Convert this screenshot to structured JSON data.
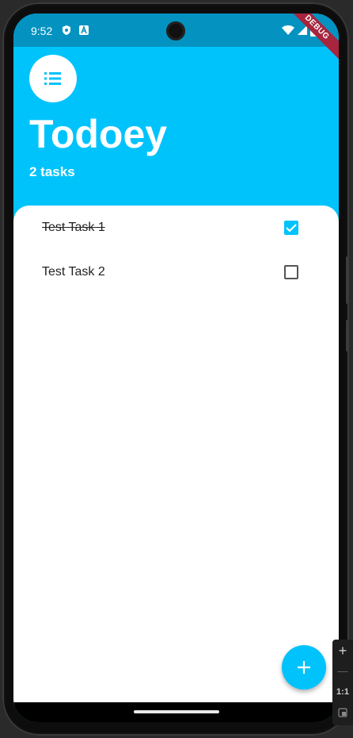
{
  "status_bar": {
    "time": "9:52",
    "debug_label": "DEBUG"
  },
  "header": {
    "title": "Todoey",
    "task_count": "2 tasks",
    "menu_icon": "list-icon"
  },
  "tasks": [
    {
      "label": "Test Task 1",
      "done": true
    },
    {
      "label": "Test Task 2",
      "done": false
    }
  ],
  "fab": {
    "icon": "plus-icon"
  },
  "emulator_toolbar": {
    "zoom_in": "+",
    "zoom_out": "—",
    "actual_size": "1:1"
  },
  "colors": {
    "accent": "#00c3fc",
    "status_bar": "#0493c0",
    "panel": "#ffffff",
    "debug_banner": "#a7253d"
  }
}
